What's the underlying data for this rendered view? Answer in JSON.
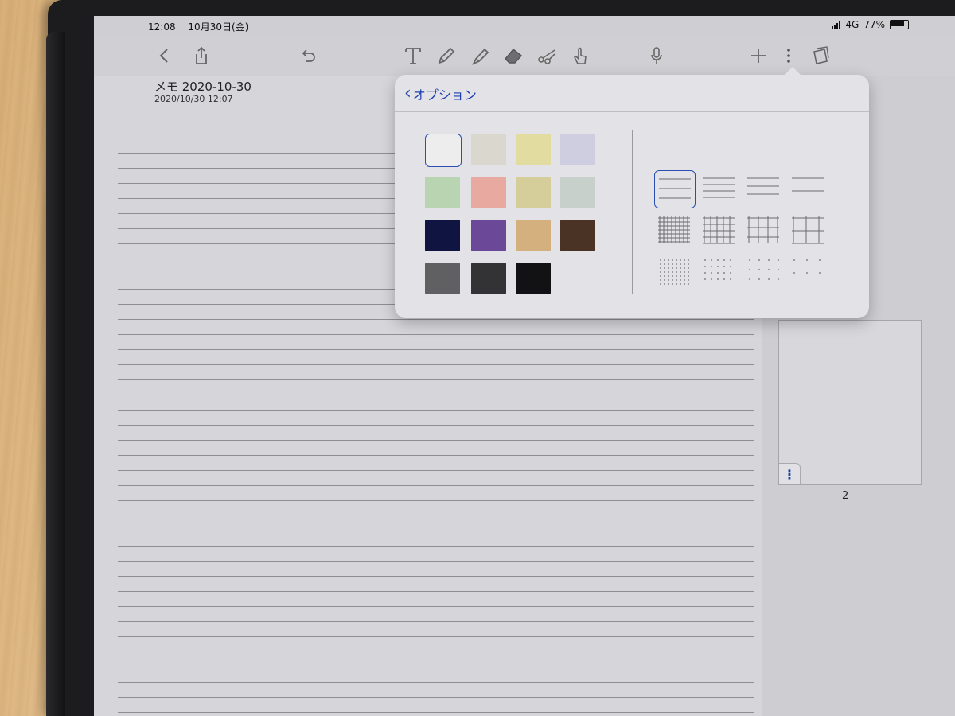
{
  "status_bar": {
    "time": "12:08",
    "date": "10月30日(金)",
    "network": "4G",
    "battery": "77%"
  },
  "toolbar": {
    "icons": [
      "back-icon",
      "share-icon",
      "undo-icon",
      "text-tool-icon",
      "pencil-icon",
      "highlighter-icon",
      "eraser-icon",
      "scissors-icon",
      "hand-icon",
      "microphone-icon",
      "add-icon",
      "more-icon",
      "pages-icon"
    ]
  },
  "note": {
    "title": "メモ 2020-10-30",
    "date": "2020/10/30 12:07"
  },
  "popover": {
    "back_label": "オプション",
    "colors": [
      "#ededed",
      "#dad7cf",
      "#e3dca0",
      "#cfcde0",
      "#b8d4b0",
      "#e8aaa0",
      "#d6ce9a",
      "#c8d0cc",
      "#0f1540",
      "#6b4898",
      "#d4b07e",
      "#4a3224",
      "#606062",
      "#333336",
      "#121214"
    ],
    "patterns": [
      "lined-wide",
      "lined-medium",
      "lined-narrow",
      "lined-sparse",
      "grid-dense",
      "grid-medium",
      "grid-wide",
      "grid-sparse",
      "dots-dense",
      "dots-medium",
      "dots-wide",
      "dots-sparse"
    ],
    "selected_color_index": 0,
    "selected_pattern_index": 0
  },
  "sidebar": {
    "page_number": "2"
  }
}
